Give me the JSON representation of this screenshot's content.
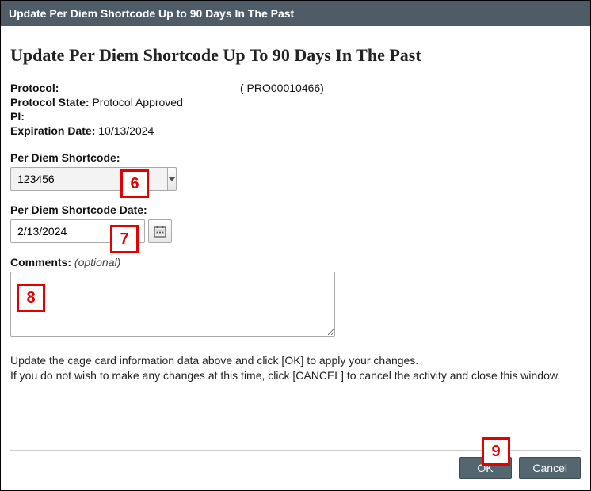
{
  "window": {
    "title": "Update Per Diem Shortcode Up to 90 Days In The Past"
  },
  "page": {
    "heading": "Update Per Diem Shortcode Up To 90 Days In The Past"
  },
  "meta": {
    "protocol_label": "Protocol:",
    "protocol_value": "( PRO00010466)",
    "state_label": "Protocol State:",
    "state_value": "Protocol Approved",
    "pi_label": "PI:",
    "pi_value": "",
    "exp_label": "Expiration Date:",
    "exp_value": "10/13/2024"
  },
  "fields": {
    "shortcode_label": "Per Diem Shortcode:",
    "shortcode_value": "123456",
    "date_label": "Per Diem Shortcode Date:",
    "date_value": "2/13/2024",
    "comments_label": "Comments:",
    "comments_optional": "(optional)",
    "comments_value": ""
  },
  "instructions": {
    "line1": "Update the cage card information data above and click [OK] to apply your changes.",
    "line2": "If you do not wish to make any changes at this time, click [CANCEL] to cancel the activity and close this window."
  },
  "buttons": {
    "ok": "OK",
    "cancel": "Cancel"
  },
  "callouts": {
    "c6": "6",
    "c7": "7",
    "c8": "8",
    "c9": "9"
  }
}
